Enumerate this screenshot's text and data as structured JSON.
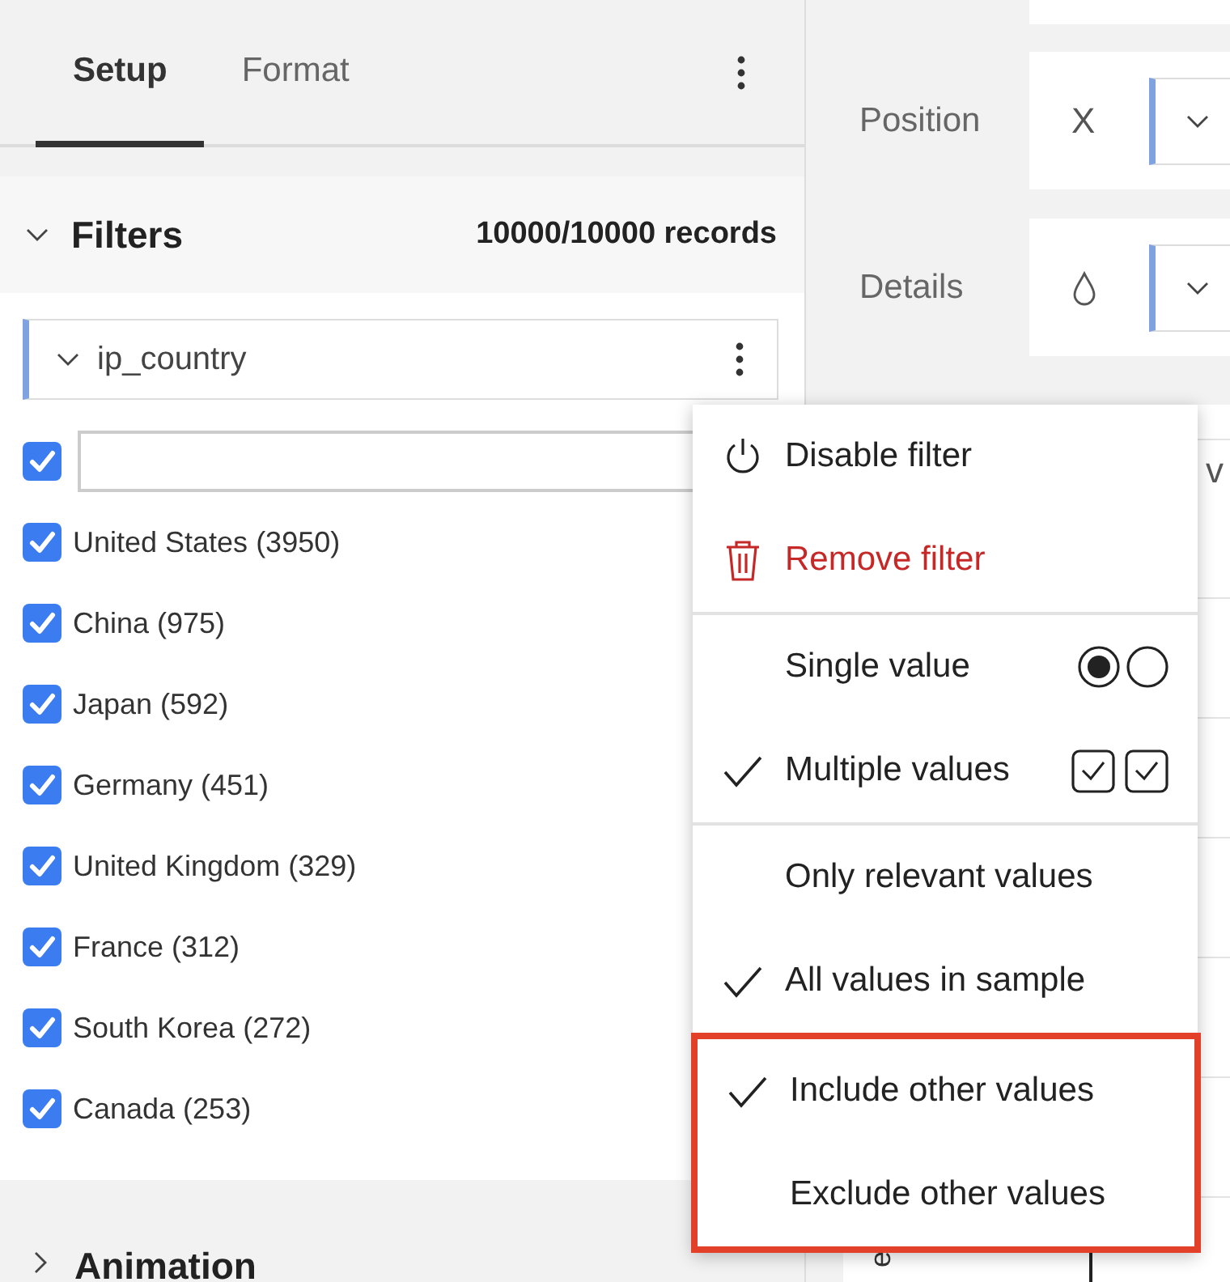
{
  "tabs": [
    {
      "label": "Setup",
      "selected": true
    },
    {
      "label": "Format",
      "selected": false
    }
  ],
  "filters": {
    "title": "Filters",
    "expanded": true,
    "records": "10000/10000 records",
    "filter": {
      "field": "ip_country",
      "expanded": true,
      "all_checked": true,
      "values": [
        {
          "label": "United States (3950)",
          "checked": true
        },
        {
          "label": "China (975)",
          "checked": true
        },
        {
          "label": "Japan (592)",
          "checked": true
        },
        {
          "label": "Germany (451)",
          "checked": true
        },
        {
          "label": "United Kingdom (329)",
          "checked": true
        },
        {
          "label": "France (312)",
          "checked": true
        },
        {
          "label": "South Korea (272)",
          "checked": true
        },
        {
          "label": "Canada (253)",
          "checked": true
        }
      ]
    }
  },
  "animation": {
    "title": "Animation",
    "expanded": false
  },
  "encodings": [
    {
      "label": "Position",
      "kind": "text",
      "value": "X"
    },
    {
      "label": "Details",
      "kind": "droplet"
    }
  ],
  "chart": {
    "title": "v",
    "axis_label": "e"
  },
  "menu": {
    "groups": [
      {
        "highlighted": false,
        "items": [
          {
            "kind": "toggle",
            "label": "Disable filter"
          },
          {
            "kind": "delete",
            "label": "Remove filter"
          }
        ]
      },
      {
        "highlighted": false,
        "items": [
          {
            "kind": "single",
            "label": "Single value",
            "checked": false
          },
          {
            "kind": "multiple",
            "label": "Multiple values",
            "checked": true
          }
        ]
      },
      {
        "highlighted": false,
        "items": [
          {
            "kind": "option",
            "label": "Only relevant values",
            "checked": false
          },
          {
            "kind": "option",
            "label": "All values in sample",
            "checked": true
          }
        ]
      },
      {
        "highlighted": true,
        "items": [
          {
            "kind": "option",
            "label": "Include other values",
            "checked": true
          },
          {
            "kind": "option",
            "label": "Exclude other values",
            "checked": false
          }
        ]
      }
    ]
  }
}
